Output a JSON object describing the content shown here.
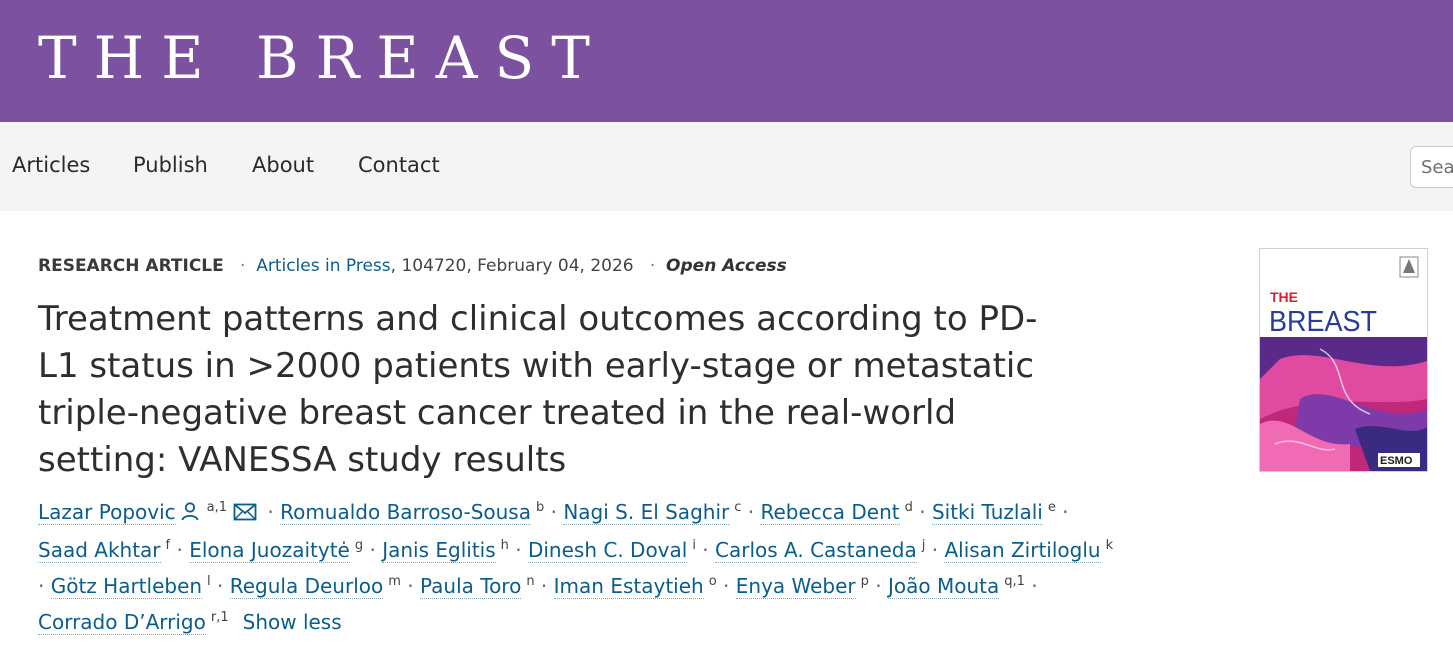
{
  "header": {
    "brand": "THE BREAST"
  },
  "nav": {
    "items": [
      "Articles",
      "Publish",
      "About",
      "Contact"
    ]
  },
  "search": {
    "placeholder": "Search"
  },
  "article": {
    "type_label": "RESEARCH ARTICLE",
    "journal_section": "Articles in Press",
    "details": ", 104720, February 04, 2026",
    "access": "Open Access",
    "title": "Treatment patterns and clinical outcomes according to PD-L1 status in >2000 patients with early-stage or metastatic triple-negative breast cancer treated in the real-world setting: VANESSA study results",
    "authors": [
      {
        "name": "Lazar Popovic",
        "aff": "a,1"
      },
      {
        "name": "Romualdo Barroso-Sousa",
        "aff": "b"
      },
      {
        "name": "Nagi S. El Saghir",
        "aff": "c"
      },
      {
        "name": "Rebecca Dent",
        "aff": "d"
      },
      {
        "name": "Sitki Tuzlali",
        "aff": "e"
      },
      {
        "name": "Saad Akhtar",
        "aff": "f"
      },
      {
        "name": "Elona Juozaitytė",
        "aff": "g"
      },
      {
        "name": "Janis Eglitis",
        "aff": "h"
      },
      {
        "name": "Dinesh C. Doval",
        "aff": "i"
      },
      {
        "name": "Carlos A. Castaneda",
        "aff": "j"
      },
      {
        "name": "Alisan Zirtiloglu",
        "aff": "k"
      },
      {
        "name": "Götz Hartleben",
        "aff": "l"
      },
      {
        "name": "Regula Deurloo",
        "aff": "m"
      },
      {
        "name": "Paula Toro",
        "aff": "n"
      },
      {
        "name": "Iman Estaytieh",
        "aff": "o"
      },
      {
        "name": "Enya Weber",
        "aff": "p"
      },
      {
        "name": "João Mouta",
        "aff": "q,1"
      },
      {
        "name": "Corrado D’Arrigo",
        "aff": "r,1"
      }
    ],
    "show_less": "Show less"
  },
  "cover": {
    "title_line1": "THE",
    "title_line2": "BREAST",
    "publisher_mark": "ESMO"
  },
  "colors": {
    "masthead": "#7b51a0",
    "nav_bg": "#f4f4f4",
    "link": "#0c5d8a",
    "cover_red": "#d91f2b",
    "cover_blue": "#2a3c9a"
  },
  "icons": [
    "person-icon",
    "envelope-icon"
  ]
}
